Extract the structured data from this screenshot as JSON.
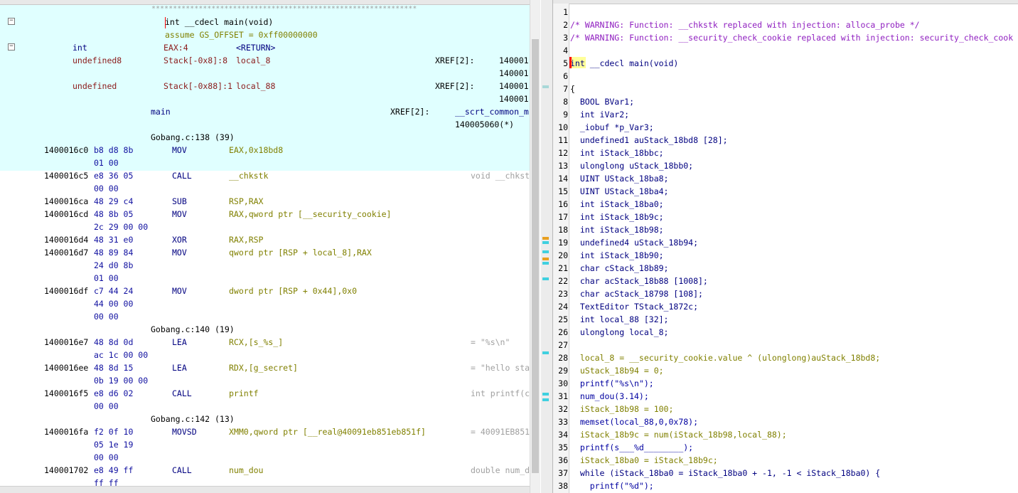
{
  "listing": {
    "stars": "**************************************************************",
    "signature": "int __cdecl main(void)",
    "assume": "assume GS_OFFSET = 0xff00000000",
    "params": [
      {
        "type": "int",
        "storage": "EAX:4",
        "name": "<RETURN>",
        "xref": "",
        "xref_addr1": "",
        "xref_addr2": ""
      },
      {
        "type": "undefined8",
        "storage": "Stack[-0x8]:8",
        "name": "local_8",
        "xref": "XREF[2]:",
        "xref_addr1": "140001",
        "xref_addr2": "140001"
      },
      {
        "type": "undefined",
        "storage": "Stack[-0x88]:1",
        "name": "local_88",
        "xref": "XREF[2]:",
        "xref_addr1": "140001",
        "xref_addr2": "140001"
      }
    ],
    "label": {
      "name": "main",
      "xref": "XREF[2]:",
      "ref1": "__scrt_common_m",
      "ref2": "140005060(*)"
    },
    "instructions": [
      {
        "kind": "src",
        "text": "Gobang.c:138 (39)"
      },
      {
        "kind": "ins",
        "addr": "1400016c0",
        "bytes": [
          "b8 d8 8b",
          "01 00"
        ],
        "mn": "MOV",
        "ops": "EAX,0x18bd8",
        "comment": ""
      },
      {
        "kind": "ins",
        "addr": "1400016c5",
        "bytes": [
          "e8 36 05",
          "00 00"
        ],
        "mn": "CALL",
        "ops": "__chkstk",
        "comment": "void __chkst"
      },
      {
        "kind": "ins",
        "addr": "1400016ca",
        "bytes": [
          "48 29 c4"
        ],
        "mn": "SUB",
        "ops": "RSP,RAX",
        "comment": ""
      },
      {
        "kind": "ins",
        "addr": "1400016cd",
        "bytes": [
          "48 8b 05",
          "2c 29 00 00"
        ],
        "mn": "MOV",
        "ops": "RAX,qword ptr [__security_cookie]",
        "comment": ""
      },
      {
        "kind": "ins",
        "addr": "1400016d4",
        "bytes": [
          "48 31 e0"
        ],
        "mn": "XOR",
        "ops": "RAX,RSP",
        "comment": ""
      },
      {
        "kind": "ins",
        "addr": "1400016d7",
        "bytes": [
          "48 89 84",
          "24 d0 8b",
          "01 00"
        ],
        "mn": "MOV",
        "ops": "qword ptr [RSP + local_8],RAX",
        "comment": ""
      },
      {
        "kind": "ins",
        "addr": "1400016df",
        "bytes": [
          "c7 44 24",
          "44 00 00",
          "00 00"
        ],
        "mn": "MOV",
        "ops": "dword ptr [RSP + 0x44],0x0",
        "comment": ""
      },
      {
        "kind": "src",
        "text": "Gobang.c:140 (19)"
      },
      {
        "kind": "ins",
        "addr": "1400016e7",
        "bytes": [
          "48 8d 0d",
          "ac 1c 00 00"
        ],
        "mn": "LEA",
        "ops": "RCX,[s_%s_]",
        "comment": "= \"%s\\n\""
      },
      {
        "kind": "ins",
        "addr": "1400016ee",
        "bytes": [
          "48 8d 15",
          "0b 19 00 00"
        ],
        "mn": "LEA",
        "ops": "RDX,[g_secret]",
        "comment": "= \"hello sta"
      },
      {
        "kind": "ins",
        "addr": "1400016f5",
        "bytes": [
          "e8 d6 02",
          "00 00"
        ],
        "mn": "CALL",
        "ops": "printf",
        "comment": "int printf(c"
      },
      {
        "kind": "src",
        "text": "Gobang.c:142 (13)"
      },
      {
        "kind": "ins",
        "addr": "1400016fa",
        "bytes": [
          "f2 0f 10",
          "05 1e 19",
          "00 00"
        ],
        "mn": "MOVSD",
        "ops": "XMM0,qword ptr [__real@40091eb851eb851f]",
        "comment": "= 40091EB851"
      },
      {
        "kind": "ins",
        "addr": "140001702",
        "bytes": [
          "e8 49 ff",
          "ff ff"
        ],
        "mn": "CALL",
        "ops": "num_dou",
        "comment": "double num_d"
      }
    ]
  },
  "decompiler": {
    "lines": [
      {
        "n": "1",
        "t": ""
      },
      {
        "n": "2",
        "t": "/* WARNING: Function: __chkstk replaced with injection: alloca_probe */"
      },
      {
        "n": "3",
        "t": "/* WARNING: Function: __security_check_cookie replaced with injection: security_check_cook"
      },
      {
        "n": "4",
        "t": ""
      },
      {
        "n": "5",
        "t": "int __cdecl main(void)"
      },
      {
        "n": "6",
        "t": ""
      },
      {
        "n": "7",
        "t": "{"
      },
      {
        "n": "8",
        "t": "  BOOL BVar1;"
      },
      {
        "n": "9",
        "t": "  int iVar2;"
      },
      {
        "n": "10",
        "t": "  _iobuf *p_Var3;"
      },
      {
        "n": "11",
        "t": "  undefined1 auStack_18bd8 [28];"
      },
      {
        "n": "12",
        "t": "  int iStack_18bbc;"
      },
      {
        "n": "13",
        "t": "  ulonglong uStack_18bb0;"
      },
      {
        "n": "14",
        "t": "  UINT UStack_18ba8;"
      },
      {
        "n": "15",
        "t": "  UINT UStack_18ba4;"
      },
      {
        "n": "16",
        "t": "  int iStack_18ba0;"
      },
      {
        "n": "17",
        "t": "  int iStack_18b9c;"
      },
      {
        "n": "18",
        "t": "  int iStack_18b98;"
      },
      {
        "n": "19",
        "t": "  undefined4 uStack_18b94;"
      },
      {
        "n": "20",
        "t": "  int iStack_18b90;"
      },
      {
        "n": "21",
        "t": "  char cStack_18b89;"
      },
      {
        "n": "22",
        "t": "  char acStack_18b88 [1008];"
      },
      {
        "n": "23",
        "t": "  char acStack_18798 [108];"
      },
      {
        "n": "24",
        "t": "  TextEditor TStack_1872c;"
      },
      {
        "n": "25",
        "t": "  int local_88 [32];"
      },
      {
        "n": "26",
        "t": "  ulonglong local_8;"
      },
      {
        "n": "27",
        "t": ""
      },
      {
        "n": "28",
        "t": "  local_8 = __security_cookie.value ^ (ulonglong)auStack_18bd8;"
      },
      {
        "n": "29",
        "t": "  uStack_18b94 = 0;"
      },
      {
        "n": "30",
        "t": "  printf(\"%s\\n\");"
      },
      {
        "n": "31",
        "t": "  num_dou(3.14);"
      },
      {
        "n": "32",
        "t": "  iStack_18b98 = 100;"
      },
      {
        "n": "33",
        "t": "  memset(local_88,0,0x78);"
      },
      {
        "n": "34",
        "t": "  iStack_18b9c = num(iStack_18b98,local_88);"
      },
      {
        "n": "35",
        "t": "  printf(s___%d________);"
      },
      {
        "n": "36",
        "t": "  iStack_18ba0 = iStack_18b9c;"
      },
      {
        "n": "37",
        "t": "  while (iStack_18ba0 = iStack_18ba0 + -1, -1 < iStack_18ba0) {"
      },
      {
        "n": "38",
        "t": "    printf(\"%d\");"
      }
    ]
  },
  "colors": {
    "listing_header_bg": "#e0ffff",
    "cursor_red": "#ff0000",
    "token_highlight": "#ffff99",
    "marker_cyan": "#40d0e0",
    "marker_orange": "#e8a020"
  }
}
